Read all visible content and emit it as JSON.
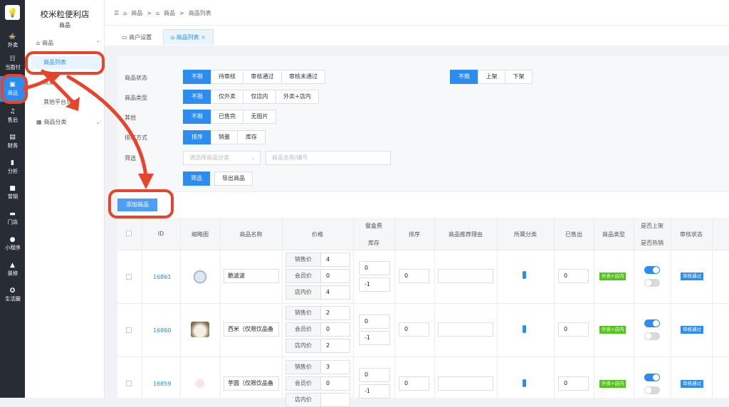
{
  "rail": {
    "items": [
      {
        "label": "外卖",
        "icon": "takeout-icon"
      },
      {
        "label": "当面付",
        "icon": "pay-icon"
      },
      {
        "label": "商品",
        "icon": "goods-icon"
      },
      {
        "label": "售后",
        "icon": "headset-icon"
      },
      {
        "label": "财务",
        "icon": "finance-icon"
      },
      {
        "label": "分析",
        "icon": "chart-icon"
      },
      {
        "label": "营销",
        "icon": "gift-icon"
      },
      {
        "label": "门店",
        "icon": "store-icon"
      },
      {
        "label": "小程序",
        "icon": "chat-icon"
      },
      {
        "label": "装修",
        "icon": "paint-icon"
      },
      {
        "label": "生活圈",
        "icon": "circle-icon"
      }
    ]
  },
  "sidebar": {
    "store_name": "校米粒便利店",
    "section": "商品",
    "group_goods": "商品",
    "items": [
      "商品列表",
      "批量",
      "其他平台导入"
    ],
    "group_category": "商品分类"
  },
  "breadcrumb": [
    "商品",
    "商品",
    "商品列表"
  ],
  "tabs": [
    {
      "label": "商户设置"
    },
    {
      "label": "商品列表",
      "close": "×"
    }
  ],
  "filters": {
    "status_label": "商品状态",
    "status_options": [
      "不限",
      "待审核",
      "审核通过",
      "审核未通过"
    ],
    "shelf_options": [
      "不限",
      "上架",
      "下架"
    ],
    "type_label": "商品类型",
    "type_options": [
      "不限",
      "仅外卖",
      "仅店内",
      "外卖+店内"
    ],
    "other_label": "其他",
    "other_options": [
      "不限",
      "已售完",
      "无图片"
    ],
    "sort_label": "排序方式",
    "sort_options": [
      "排序",
      "销量",
      "库存"
    ],
    "screen_label": "筛选",
    "category_placeholder": "请选择商品分类",
    "name_placeholder": "商品名称/编号",
    "filter_button": "筛选",
    "export_button": "导出商品"
  },
  "add_button": "添加商品",
  "table": {
    "headers": {
      "id": "ID",
      "thumb": "缩略图",
      "name": "商品名称",
      "price": "价格",
      "box_fee": "餐盒费",
      "stock": "库存",
      "sort": "排序",
      "reason": "商品推荐理由",
      "category": "所属分类",
      "sold": "已售出",
      "type": "商品类型",
      "on_shelf": "是否上架",
      "hot": "是否热销",
      "audit": "审核状态"
    },
    "price_labels": [
      "销售价",
      "会员价",
      "店内价"
    ],
    "rows": [
      {
        "id": "16861",
        "name": "脆波波",
        "prices": [
          "4",
          "0",
          "4"
        ],
        "box_fee": "0",
        "stock": "-1",
        "sort": "0",
        "sold": "0",
        "type": "外卖+店内",
        "audit": "审核通过"
      },
      {
        "id": "16860",
        "name": "西米（仅限饮品备",
        "prices": [
          "2",
          "0",
          "2"
        ],
        "box_fee": "0",
        "stock": "-1",
        "sort": "0",
        "sold": "0",
        "type": "外卖+店内",
        "audit": "审核通过"
      },
      {
        "id": "16859",
        "name": "芋圆（仅限饮品备",
        "prices": [
          "3",
          "0",
          ""
        ],
        "box_fee": "0",
        "stock": "-1",
        "sort": "0",
        "sold": "0",
        "type": "外卖+店内",
        "audit": "审核通过"
      }
    ]
  },
  "colors": {
    "accent": "#2d8cf0",
    "annotation": "#e8432b",
    "rail": "#282c34"
  }
}
